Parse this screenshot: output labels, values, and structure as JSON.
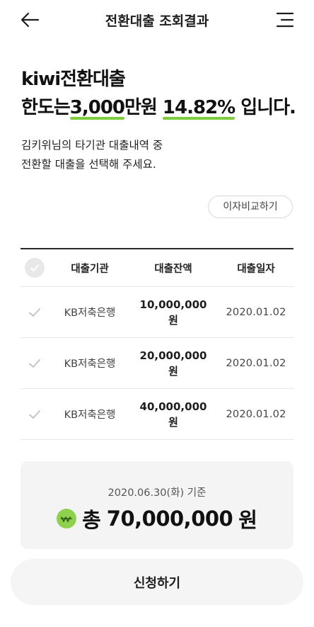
{
  "header": {
    "title": "전환대출 조회결과",
    "back_icon": "arrow-left-icon",
    "menu_icon": "menu-icon"
  },
  "headline": {
    "line1": "kiwi전환대출",
    "prefix": "한도는",
    "limit": "3,000",
    "limit_unit": "만원",
    "rate": "14.82%",
    "suffix": "입니다."
  },
  "description": {
    "line1": "김키위님의 타기관 대출내역 중",
    "line2": "전환할 대출을 선택해 주세요."
  },
  "compare_button": "이자비교하기",
  "table": {
    "columns": [
      "대출기관",
      "대출잔액",
      "대출일자"
    ],
    "rows": [
      {
        "bank": "KB저축은행",
        "amount": "10,000,000",
        "unit": "원",
        "date": "2020.01.02"
      },
      {
        "bank": "KB저축은행",
        "amount": "20,000,000",
        "unit": "원",
        "date": "2020.01.02"
      },
      {
        "bank": "KB저축은행",
        "amount": "40,000,000",
        "unit": "원",
        "date": "2020.01.02"
      }
    ]
  },
  "summary": {
    "date": "2020.06.30(화) 기준",
    "total_prefix": "총",
    "total_amount": "70,000,000",
    "total_unit": "원",
    "icon": "won-icon"
  },
  "apply_button": "신청하기",
  "colors": {
    "accent": "#7fcc3c",
    "icon_green": "#8fd14f",
    "summary_bg": "#f4f4f4",
    "check_gray": "#c4c4c4"
  }
}
